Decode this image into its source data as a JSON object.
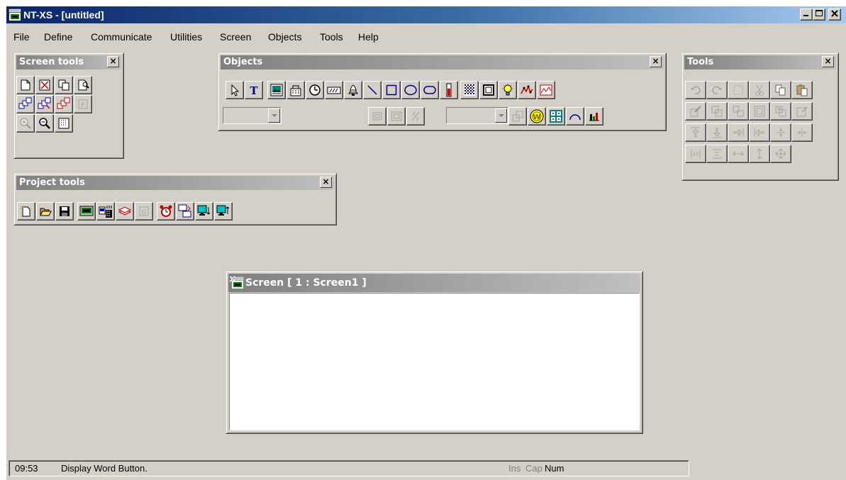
{
  "app": {
    "title": "NT-XS - [untitled]",
    "caption_buttons": {
      "minimize": "_",
      "maximize": "□",
      "close": "×"
    }
  },
  "menu": [
    "File",
    "Define",
    "Communicate",
    "Utilities",
    "Screen",
    "Objects",
    "Tools",
    "Help"
  ],
  "screen_tools": {
    "title": "Screen tools",
    "close": "×",
    "buttons": [
      "new-screen-icon",
      "delete-screen-icon",
      "copy-screen-icon",
      "screen-properties-icon",
      "overlap-screen-icon",
      "overlap-screen-2-icon",
      "overlap-screen-3-icon",
      "function-icon",
      "zoom-in-icon",
      "zoom-out-icon",
      "grid-icon"
    ],
    "function_label": "F"
  },
  "objects": {
    "title": "Objects",
    "close": "×",
    "text_tool_label": "T"
  },
  "tools": {
    "title": "Tools",
    "close": "×"
  },
  "project_tools": {
    "title": "Project tools",
    "close": "×",
    "g_label": "G"
  },
  "screen_window": {
    "title": "Screen [ 1 : Screen1 ]",
    "close": "×"
  },
  "status": {
    "time": "09:53",
    "message": "Display Word Button.",
    "ins": "Ins",
    "cap": "Cap",
    "num": "Num"
  },
  "colors": {
    "active_title_start": "#0a246a",
    "active_title_end": "#a6caf0",
    "inactive_title": "#808080",
    "face": "#d4d0c8"
  }
}
